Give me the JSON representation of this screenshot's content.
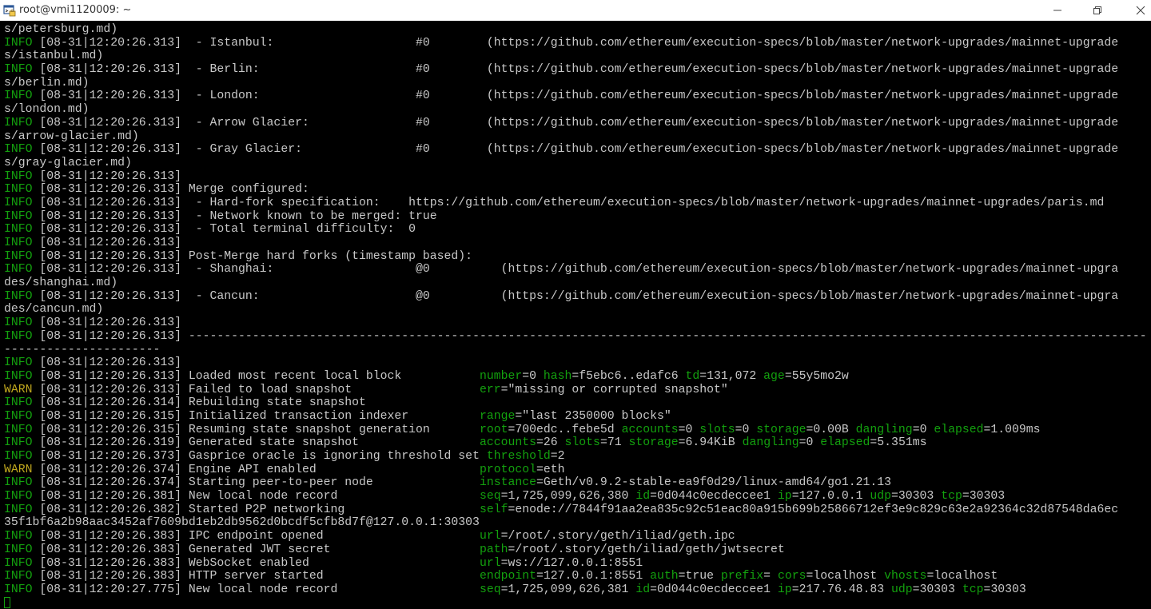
{
  "window": {
    "title": "root@vmi1120009: ~"
  },
  "icons": {
    "app": "terminal-app-icon",
    "minimize": "minimize-icon",
    "maximize": "maximize-icon",
    "close": "close-icon"
  },
  "colors": {
    "terminal_background": "#000000",
    "text": "#c8c8c8",
    "info_level": "#13a10e",
    "warn_level": "#c1a81e",
    "key": "#13a10e"
  },
  "terminal": {
    "lines": [
      {
        "segments": [
          {
            "t": "s/petersburg.md)"
          }
        ]
      },
      {
        "segments": [
          {
            "t": "INFO",
            "c": "lv-info"
          },
          {
            "t": " [08-31|12:20:26.313]  - Istanbul:                    #0        (https://github.com/ethereum/execution-specs/blob/master/network-upgrades/mainnet-upgrade"
          }
        ]
      },
      {
        "segments": [
          {
            "t": "s/istanbul.md)"
          }
        ]
      },
      {
        "segments": [
          {
            "t": "INFO",
            "c": "lv-info"
          },
          {
            "t": " [08-31|12:20:26.313]  - Berlin:                      #0        (https://github.com/ethereum/execution-specs/blob/master/network-upgrades/mainnet-upgrade"
          }
        ]
      },
      {
        "segments": [
          {
            "t": "s/berlin.md)"
          }
        ]
      },
      {
        "segments": [
          {
            "t": "INFO",
            "c": "lv-info"
          },
          {
            "t": " [08-31|12:20:26.313]  - London:                      #0        (https://github.com/ethereum/execution-specs/blob/master/network-upgrades/mainnet-upgrade"
          }
        ]
      },
      {
        "segments": [
          {
            "t": "s/london.md)"
          }
        ]
      },
      {
        "segments": [
          {
            "t": "INFO",
            "c": "lv-info"
          },
          {
            "t": " [08-31|12:20:26.313]  - Arrow Glacier:               #0        (https://github.com/ethereum/execution-specs/blob/master/network-upgrades/mainnet-upgrade"
          }
        ]
      },
      {
        "segments": [
          {
            "t": "s/arrow-glacier.md)"
          }
        ]
      },
      {
        "segments": [
          {
            "t": "INFO",
            "c": "lv-info"
          },
          {
            "t": " [08-31|12:20:26.313]  - Gray Glacier:                #0        (https://github.com/ethereum/execution-specs/blob/master/network-upgrades/mainnet-upgrade"
          }
        ]
      },
      {
        "segments": [
          {
            "t": "s/gray-glacier.md)"
          }
        ]
      },
      {
        "segments": [
          {
            "t": "INFO",
            "c": "lv-info"
          },
          {
            "t": " [08-31|12:20:26.313]"
          }
        ]
      },
      {
        "segments": [
          {
            "t": "INFO",
            "c": "lv-info"
          },
          {
            "t": " [08-31|12:20:26.313] Merge configured:"
          }
        ]
      },
      {
        "segments": [
          {
            "t": "INFO",
            "c": "lv-info"
          },
          {
            "t": " [08-31|12:20:26.313]  - Hard-fork specification:    https://github.com/ethereum/execution-specs/blob/master/network-upgrades/mainnet-upgrades/paris.md"
          }
        ]
      },
      {
        "segments": [
          {
            "t": "INFO",
            "c": "lv-info"
          },
          {
            "t": " [08-31|12:20:26.313]  - Network known to be merged: true"
          }
        ]
      },
      {
        "segments": [
          {
            "t": "INFO",
            "c": "lv-info"
          },
          {
            "t": " [08-31|12:20:26.313]  - Total terminal difficulty:  0"
          }
        ]
      },
      {
        "segments": [
          {
            "t": "INFO",
            "c": "lv-info"
          },
          {
            "t": " [08-31|12:20:26.313]"
          }
        ]
      },
      {
        "segments": [
          {
            "t": "INFO",
            "c": "lv-info"
          },
          {
            "t": " [08-31|12:20:26.313] Post-Merge hard forks (timestamp based):"
          }
        ]
      },
      {
        "segments": [
          {
            "t": "INFO",
            "c": "lv-info"
          },
          {
            "t": " [08-31|12:20:26.313]  - Shanghai:                    @0          (https://github.com/ethereum/execution-specs/blob/master/network-upgrades/mainnet-upgra"
          }
        ]
      },
      {
        "segments": [
          {
            "t": "des/shanghai.md)"
          }
        ]
      },
      {
        "segments": [
          {
            "t": "INFO",
            "c": "lv-info"
          },
          {
            "t": " [08-31|12:20:26.313]  - Cancun:                      @0          (https://github.com/ethereum/execution-specs/blob/master/network-upgrades/mainnet-upgra"
          }
        ]
      },
      {
        "segments": [
          {
            "t": "des/cancun.md)"
          }
        ]
      },
      {
        "segments": [
          {
            "t": "INFO",
            "c": "lv-info"
          },
          {
            "t": " [08-31|12:20:26.313]"
          }
        ]
      },
      {
        "segments": [
          {
            "t": "INFO",
            "c": "lv-info"
          },
          {
            "t": " [08-31|12:20:26.313] ------------------------------------------------------------------------------------------------------------------------------------------"
          }
        ]
      },
      {
        "segments": [
          {
            "t": "----------------------"
          }
        ]
      },
      {
        "segments": [
          {
            "t": "INFO",
            "c": "lv-info"
          },
          {
            "t": " [08-31|12:20:26.313]"
          }
        ]
      },
      {
        "segments": [
          {
            "t": "INFO",
            "c": "lv-info"
          },
          {
            "t": " [08-31|12:20:26.313] Loaded most recent local block           "
          },
          {
            "t": "number",
            "c": "k"
          },
          {
            "t": "=0 "
          },
          {
            "t": "hash",
            "c": "k"
          },
          {
            "t": "=f5ebc6..edafc6 "
          },
          {
            "t": "td",
            "c": "k"
          },
          {
            "t": "=131,072 "
          },
          {
            "t": "age",
            "c": "k"
          },
          {
            "t": "=55y5mo2w"
          }
        ]
      },
      {
        "segments": [
          {
            "t": "WARN",
            "c": "lv-warn"
          },
          {
            "t": " [08-31|12:20:26.313] Failed to load snapshot                  "
          },
          {
            "t": "err",
            "c": "k"
          },
          {
            "t": "=\"missing or corrupted snapshot\""
          }
        ]
      },
      {
        "segments": [
          {
            "t": "INFO",
            "c": "lv-info"
          },
          {
            "t": " [08-31|12:20:26.314] Rebuilding state snapshot"
          }
        ]
      },
      {
        "segments": [
          {
            "t": "INFO",
            "c": "lv-info"
          },
          {
            "t": " [08-31|12:20:26.315] Initialized transaction indexer          "
          },
          {
            "t": "range",
            "c": "k"
          },
          {
            "t": "=\"last 2350000 blocks\""
          }
        ]
      },
      {
        "segments": [
          {
            "t": "INFO",
            "c": "lv-info"
          },
          {
            "t": " [08-31|12:20:26.315] Resuming state snapshot generation       "
          },
          {
            "t": "root",
            "c": "k"
          },
          {
            "t": "=700edc..febe5d "
          },
          {
            "t": "accounts",
            "c": "k"
          },
          {
            "t": "=0 "
          },
          {
            "t": "slots",
            "c": "k"
          },
          {
            "t": "=0 "
          },
          {
            "t": "storage",
            "c": "k"
          },
          {
            "t": "=0.00B "
          },
          {
            "t": "dangling",
            "c": "k"
          },
          {
            "t": "=0 "
          },
          {
            "t": "elapsed",
            "c": "k"
          },
          {
            "t": "=1.009ms"
          }
        ]
      },
      {
        "segments": [
          {
            "t": "INFO",
            "c": "lv-info"
          },
          {
            "t": " [08-31|12:20:26.319] Generated state snapshot                 "
          },
          {
            "t": "accounts",
            "c": "k"
          },
          {
            "t": "=26 "
          },
          {
            "t": "slots",
            "c": "k"
          },
          {
            "t": "=71 "
          },
          {
            "t": "storage",
            "c": "k"
          },
          {
            "t": "=6.94KiB "
          },
          {
            "t": "dangling",
            "c": "k"
          },
          {
            "t": "=0 "
          },
          {
            "t": "elapsed",
            "c": "k"
          },
          {
            "t": "=5.351ms"
          }
        ]
      },
      {
        "segments": [
          {
            "t": "INFO",
            "c": "lv-info"
          },
          {
            "t": " [08-31|12:20:26.373] Gasprice oracle is ignoring threshold set "
          },
          {
            "t": "threshold",
            "c": "k"
          },
          {
            "t": "=2"
          }
        ]
      },
      {
        "segments": [
          {
            "t": "WARN",
            "c": "lv-warn"
          },
          {
            "t": " [08-31|12:20:26.374] Engine API enabled                       "
          },
          {
            "t": "protocol",
            "c": "k"
          },
          {
            "t": "=eth"
          }
        ]
      },
      {
        "segments": [
          {
            "t": "INFO",
            "c": "lv-info"
          },
          {
            "t": " [08-31|12:20:26.374] Starting peer-to-peer node               "
          },
          {
            "t": "instance",
            "c": "k"
          },
          {
            "t": "=Geth/v0.9.2-stable-ea9f0d29/linux-amd64/go1.21.13"
          }
        ]
      },
      {
        "segments": [
          {
            "t": "INFO",
            "c": "lv-info"
          },
          {
            "t": " [08-31|12:20:26.381] New local node record                    "
          },
          {
            "t": "seq",
            "c": "k"
          },
          {
            "t": "=1,725,099,626,380 "
          },
          {
            "t": "id",
            "c": "k"
          },
          {
            "t": "=0d044c0ecdeccee1 "
          },
          {
            "t": "ip",
            "c": "k"
          },
          {
            "t": "=127.0.0.1 "
          },
          {
            "t": "udp",
            "c": "k"
          },
          {
            "t": "=30303 "
          },
          {
            "t": "tcp",
            "c": "k"
          },
          {
            "t": "=30303"
          }
        ]
      },
      {
        "segments": [
          {
            "t": "INFO",
            "c": "lv-info"
          },
          {
            "t": " [08-31|12:20:26.382] Started P2P networking                   "
          },
          {
            "t": "self",
            "c": "k"
          },
          {
            "t": "=enode://7844f91aa2ea835c92c51eac80a915b699b25866712ef3e9c829c63e2a92364c32d87548da6ec"
          }
        ]
      },
      {
        "segments": [
          {
            "t": "35f1bf6a2b98aac3452af7609bd1eb2db9562d0bcdf5cfb8d7f@127.0.0.1:30303"
          }
        ]
      },
      {
        "segments": [
          {
            "t": "INFO",
            "c": "lv-info"
          },
          {
            "t": " [08-31|12:20:26.383] IPC endpoint opened                      "
          },
          {
            "t": "url",
            "c": "k"
          },
          {
            "t": "=/root/.story/geth/iliad/geth.ipc"
          }
        ]
      },
      {
        "segments": [
          {
            "t": "INFO",
            "c": "lv-info"
          },
          {
            "t": " [08-31|12:20:26.383] Generated JWT secret                     "
          },
          {
            "t": "path",
            "c": "k"
          },
          {
            "t": "=/root/.story/geth/iliad/geth/jwtsecret"
          }
        ]
      },
      {
        "segments": [
          {
            "t": "INFO",
            "c": "lv-info"
          },
          {
            "t": " [08-31|12:20:26.383] WebSocket enabled                        "
          },
          {
            "t": "url",
            "c": "k"
          },
          {
            "t": "=ws://127.0.0.1:8551"
          }
        ]
      },
      {
        "segments": [
          {
            "t": "INFO",
            "c": "lv-info"
          },
          {
            "t": " [08-31|12:20:26.383] HTTP server started                      "
          },
          {
            "t": "endpoint",
            "c": "k"
          },
          {
            "t": "=127.0.0.1:8551 "
          },
          {
            "t": "auth",
            "c": "k"
          },
          {
            "t": "=true "
          },
          {
            "t": "prefix",
            "c": "k"
          },
          {
            "t": "= "
          },
          {
            "t": "cors",
            "c": "k"
          },
          {
            "t": "=localhost "
          },
          {
            "t": "vhosts",
            "c": "k"
          },
          {
            "t": "=localhost"
          }
        ]
      },
      {
        "segments": [
          {
            "t": "INFO",
            "c": "lv-info"
          },
          {
            "t": " [08-31|12:20:27.775] New local node record                    "
          },
          {
            "t": "seq",
            "c": "k"
          },
          {
            "t": "=1,725,099,626,381 "
          },
          {
            "t": "id",
            "c": "k"
          },
          {
            "t": "=0d044c0ecdeccee1 "
          },
          {
            "t": "ip",
            "c": "k"
          },
          {
            "t": "=217.76.48.83 "
          },
          {
            "t": "udp",
            "c": "k"
          },
          {
            "t": "=30303 "
          },
          {
            "t": "tcp",
            "c": "k"
          },
          {
            "t": "=30303"
          }
        ]
      }
    ]
  }
}
